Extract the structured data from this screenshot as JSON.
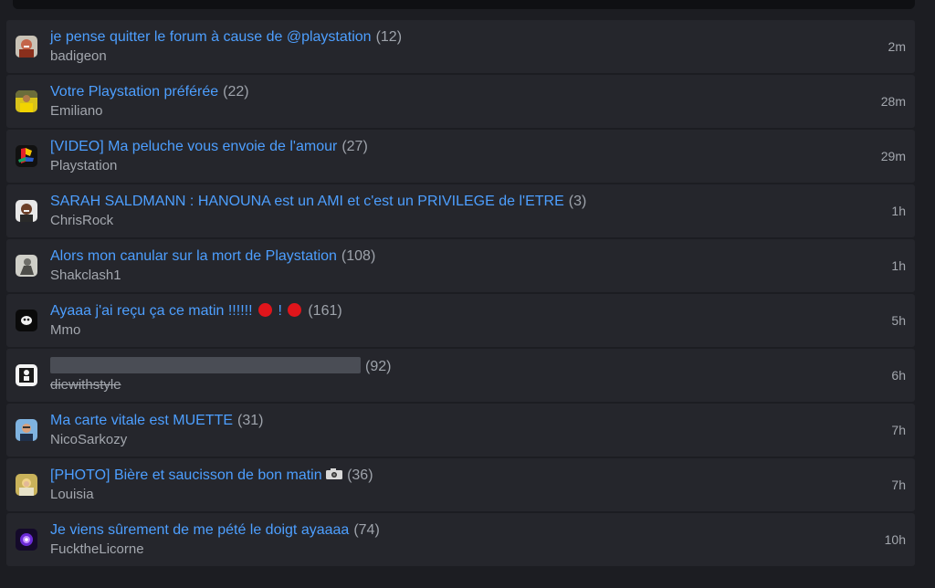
{
  "topics": [
    {
      "title": "je pense quitter le forum à cause de @playstation",
      "count": "(12)",
      "author": "badigeon",
      "time": "2m",
      "avatar": "avatar-laughing-man"
    },
    {
      "title": "Votre Playstation préférée",
      "count": "(22)",
      "author": "Emiliano",
      "time": "28m",
      "avatar": "avatar-yellow-jersey"
    },
    {
      "title": "[VIDEO] Ma peluche vous envoie de l'amour",
      "count": "(27)",
      "author": "Playstation",
      "time": "29m",
      "avatar": "avatar-playstation-logo"
    },
    {
      "title": "SARAH SALDMANN : HANOUNA est un AMI et c'est un PRIVILEGE de l'ETRE",
      "count": "(3)",
      "author": "ChrisRock",
      "time": "1h",
      "avatar": "avatar-man-portrait"
    },
    {
      "title": "Alors mon canular sur la mort de Playstation",
      "count": "(108)",
      "author": "Shakclash1",
      "time": "1h",
      "avatar": "avatar-grey-figure"
    },
    {
      "title_part1": "Ayaaa j'ai reçu ça ce matin !!!!!!",
      "title_part2": "!",
      "count": "(161)",
      "author": "Mmo",
      "time": "5h",
      "avatar": "avatar-black-face"
    },
    {
      "count": "(92)",
      "author": "diewithstyle",
      "time": "6h",
      "avatar": "avatar-bw-figure"
    },
    {
      "title": "Ma carte vitale est MUETTE",
      "count": "(31)",
      "author": "NicoSarkozy",
      "time": "7h",
      "avatar": "avatar-sarkozy"
    },
    {
      "title": "[PHOTO] Bière et saucisson de bon matin",
      "count": "(36)",
      "author": "Louisia",
      "time": "7h",
      "avatar": "avatar-blonde-woman"
    },
    {
      "title": "Je viens sûrement de me pété le doigt ayaaaa",
      "count": "(74)",
      "author": "FucktheLicorne",
      "time": "10h",
      "avatar": "avatar-purple-glow"
    }
  ],
  "colors": {
    "background": "#1c1d22",
    "row": "#25262c",
    "link": "#4d9fff",
    "muted": "#a3a7ae",
    "red_emoji": "#e0151b"
  }
}
